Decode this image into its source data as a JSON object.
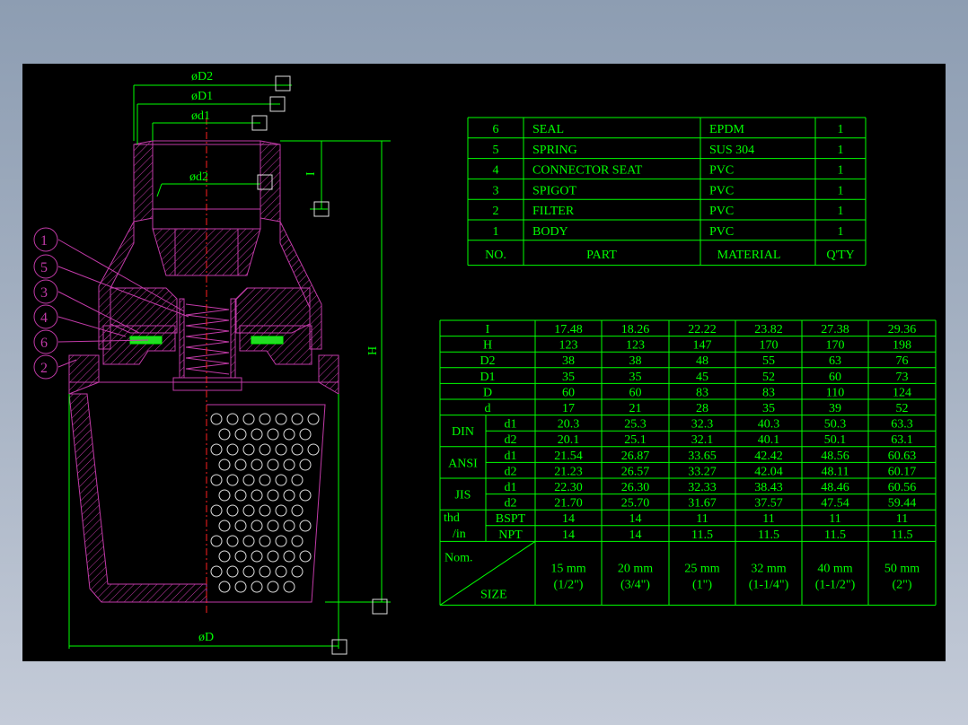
{
  "colors": {
    "background": "#000000",
    "lines": "#00ff00",
    "part": "#c13aa7",
    "centerline": "#ff2020",
    "seal": "#22dd22"
  },
  "dimensions": {
    "D2": "øD2",
    "D1": "øD1",
    "d1": "ød1",
    "d2": "ød2",
    "I": "I",
    "H": "H",
    "D": "øD"
  },
  "balloons": [
    "1",
    "5",
    "3",
    "4",
    "6",
    "2"
  ],
  "parts_table": {
    "headers": [
      "NO.",
      "PART",
      "MATERIAL",
      "Q'TY"
    ],
    "rows": [
      {
        "no": "6",
        "part": "SEAL",
        "material": "EPDM",
        "qty": "1"
      },
      {
        "no": "5",
        "part": "SPRING",
        "material": "SUS 304",
        "qty": "1"
      },
      {
        "no": "4",
        "part": "CONNECTOR SEAT",
        "material": "PVC",
        "qty": "1"
      },
      {
        "no": "3",
        "part": "SPIGOT",
        "material": "PVC",
        "qty": "1"
      },
      {
        "no": "2",
        "part": "FILTER",
        "material": "PVC",
        "qty": "1"
      },
      {
        "no": "1",
        "part": "BODY",
        "material": "PVC",
        "qty": "1"
      }
    ]
  },
  "size_table": {
    "rows": [
      {
        "label": "I",
        "values": [
          "17.48",
          "18.26",
          "22.22",
          "23.82",
          "27.38",
          "29.36"
        ]
      },
      {
        "label": "H",
        "values": [
          "123",
          "123",
          "147",
          "170",
          "170",
          "198"
        ]
      },
      {
        "label": "D2",
        "values": [
          "38",
          "38",
          "48",
          "55",
          "63",
          "76"
        ]
      },
      {
        "label": "D1",
        "values": [
          "35",
          "35",
          "45",
          "52",
          "60",
          "73"
        ]
      },
      {
        "label": "D",
        "values": [
          "60",
          "60",
          "83",
          "83",
          "110",
          "124"
        ]
      },
      {
        "label": "d",
        "values": [
          "17",
          "21",
          "28",
          "35",
          "39",
          "52"
        ]
      }
    ],
    "groups": [
      {
        "label": "DIN",
        "rows": [
          {
            "sub": "d1",
            "values": [
              "20.3",
              "25.3",
              "32.3",
              "40.3",
              "50.3",
              "63.3"
            ]
          },
          {
            "sub": "d2",
            "values": [
              "20.1",
              "25.1",
              "32.1",
              "40.1",
              "50.1",
              "63.1"
            ]
          }
        ]
      },
      {
        "label": "ANSI",
        "rows": [
          {
            "sub": "d1",
            "values": [
              "21.54",
              "26.87",
              "33.65",
              "42.42",
              "48.56",
              "60.63"
            ]
          },
          {
            "sub": "d2",
            "values": [
              "21.23",
              "26.57",
              "33.27",
              "42.04",
              "48.11",
              "60.17"
            ]
          }
        ]
      },
      {
        "label": "JIS",
        "rows": [
          {
            "sub": "d1",
            "values": [
              "22.30",
              "26.30",
              "32.33",
              "38.43",
              "48.46",
              "60.56"
            ]
          },
          {
            "sub": "d2",
            "values": [
              "21.70",
              "25.70",
              "31.67",
              "37.57",
              "47.54",
              "59.44"
            ]
          }
        ]
      },
      {
        "label_top": "thd",
        "label_bottom": "/in",
        "rows": [
          {
            "sub": "BSPT",
            "values": [
              "14",
              "14",
              "11",
              "11",
              "11",
              "11"
            ]
          },
          {
            "sub": "NPT",
            "values": [
              "14",
              "14",
              "11.5",
              "11.5",
              "11.5",
              "11.5"
            ]
          }
        ]
      }
    ],
    "nom_label": "Nom.",
    "size_label": "SIZE",
    "sizes": [
      {
        "mm": "15 mm",
        "inch": "(1/2\")"
      },
      {
        "mm": "20 mm",
        "inch": "(3/4\")"
      },
      {
        "mm": "25 mm",
        "inch": "(1\")"
      },
      {
        "mm": "32 mm",
        "inch": "(1-1/4\")"
      },
      {
        "mm": "40 mm",
        "inch": "(1-1/2\")"
      },
      {
        "mm": "50 mm",
        "inch": "(2\")"
      }
    ]
  }
}
